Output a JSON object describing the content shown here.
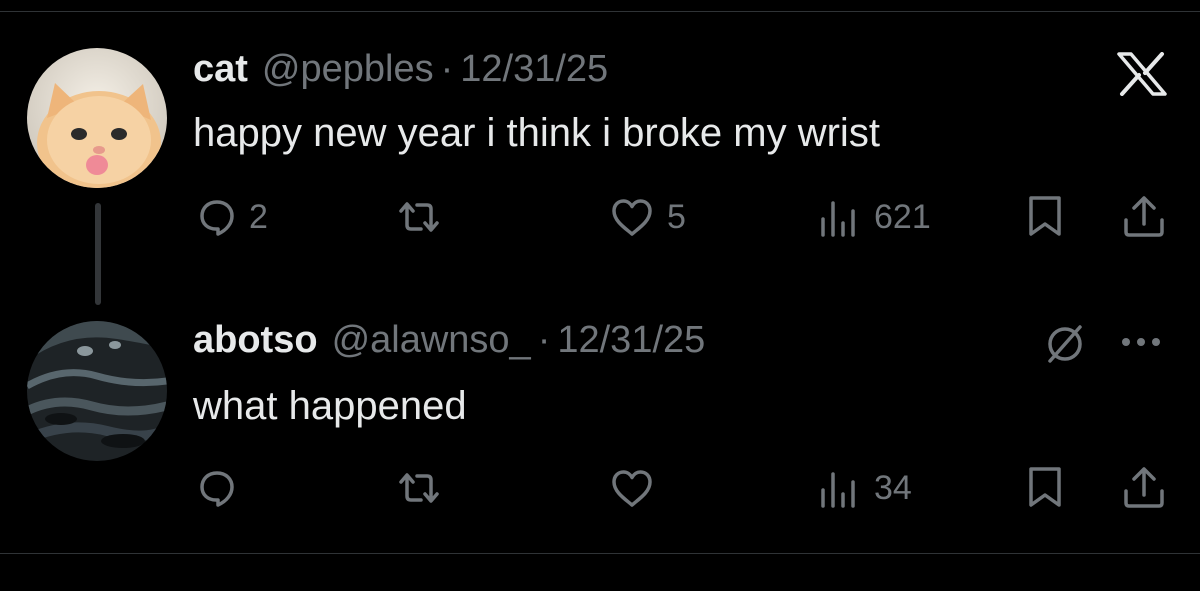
{
  "tweets": [
    {
      "name": "cat",
      "handle": "@pepbles",
      "separator": "·",
      "date": "12/31/25",
      "text": "happy new year i think i broke my wrist",
      "replies": "2",
      "likes": "5",
      "views": "621",
      "corner_icon": "x-logo-icon",
      "avatar_icon": "kitten-avatar"
    },
    {
      "name": "abotso",
      "handle": "@alawnso_",
      "separator": "·",
      "date": "12/31/25",
      "text": "what happened",
      "views": "34",
      "corner_icons": [
        "circle-slash-icon",
        "more-dots-icon"
      ],
      "avatar_icon": "dark-abstract-avatar"
    }
  ],
  "colors": {
    "background": "#000000",
    "text": "#e7e9ea",
    "muted": "#71767b",
    "divider": "#2f3336"
  }
}
